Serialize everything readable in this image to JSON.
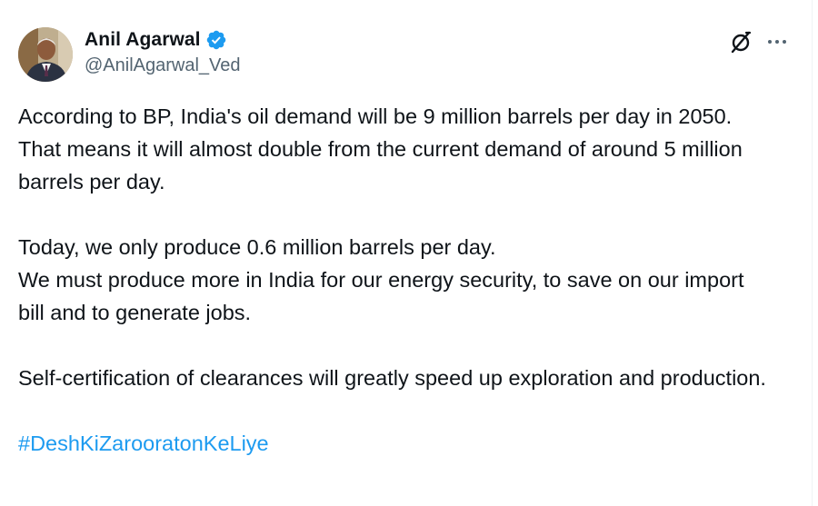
{
  "author": {
    "display_name": "Anil Agarwal",
    "handle": "@AnilAgarwal_Ved",
    "verified": true,
    "avatar_icon": "profile-photo"
  },
  "header_actions": {
    "grok_icon": "grok-slash-circle-icon",
    "more_icon": "more-dots-icon"
  },
  "tweet": {
    "paragraph_1": "According to BP, India's oil demand will be 9 million barrels per day in 2050. That means it will almost double from the current demand of around 5 million barrels per day.",
    "paragraph_2_line_1": "Today, we only produce 0.6 million barrels per day.",
    "paragraph_2_line_2": "We must produce more in India for our energy security, to save on our import bill and to generate jobs.",
    "paragraph_3": "Self-certification of clearances will greatly speed up exploration and production.",
    "hashtag": "#DeshKiZarooratonKeLiye"
  },
  "colors": {
    "text": "#0f1419",
    "secondary_text": "#536471",
    "accent": "#1d9bf0"
  }
}
